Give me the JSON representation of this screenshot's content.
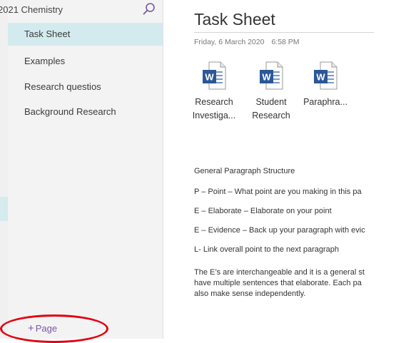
{
  "notebook": {
    "title": "2021 Chemistry",
    "search_icon": "search-icon",
    "accent": "#7a57a6"
  },
  "pages": [
    {
      "label": "Task Sheet",
      "selected": true
    },
    {
      "label": "Examples",
      "selected": false
    },
    {
      "label": "Research questios",
      "selected": false
    },
    {
      "label": "Background Research",
      "selected": false
    }
  ],
  "add_page": {
    "plus": "+",
    "label": "Page"
  },
  "page": {
    "title": "Task Sheet",
    "date": "Friday, 6 March 2020",
    "time": "6:58 PM",
    "attachments": [
      {
        "icon": "word-doc-icon",
        "line1": "Research",
        "line2": "Investiga..."
      },
      {
        "icon": "word-doc-icon",
        "line1": "Student",
        "line2": "Research"
      },
      {
        "icon": "word-doc-icon",
        "line1": "Paraphra...",
        "line2": ""
      }
    ],
    "heading": "General Paragraph Structure",
    "lines": [
      "P – Point – What point are you making in this pa",
      "E – Elaborate – Elaborate on your point",
      "E – Evidence – Back up your paragraph with evic",
      "L- Link overall point to the next paragraph"
    ],
    "paragraph": [
      "The E’s are interchangeable and it is a general st",
      "have multiple sentences that elaborate. Each pa",
      "also make sense independently."
    ]
  }
}
